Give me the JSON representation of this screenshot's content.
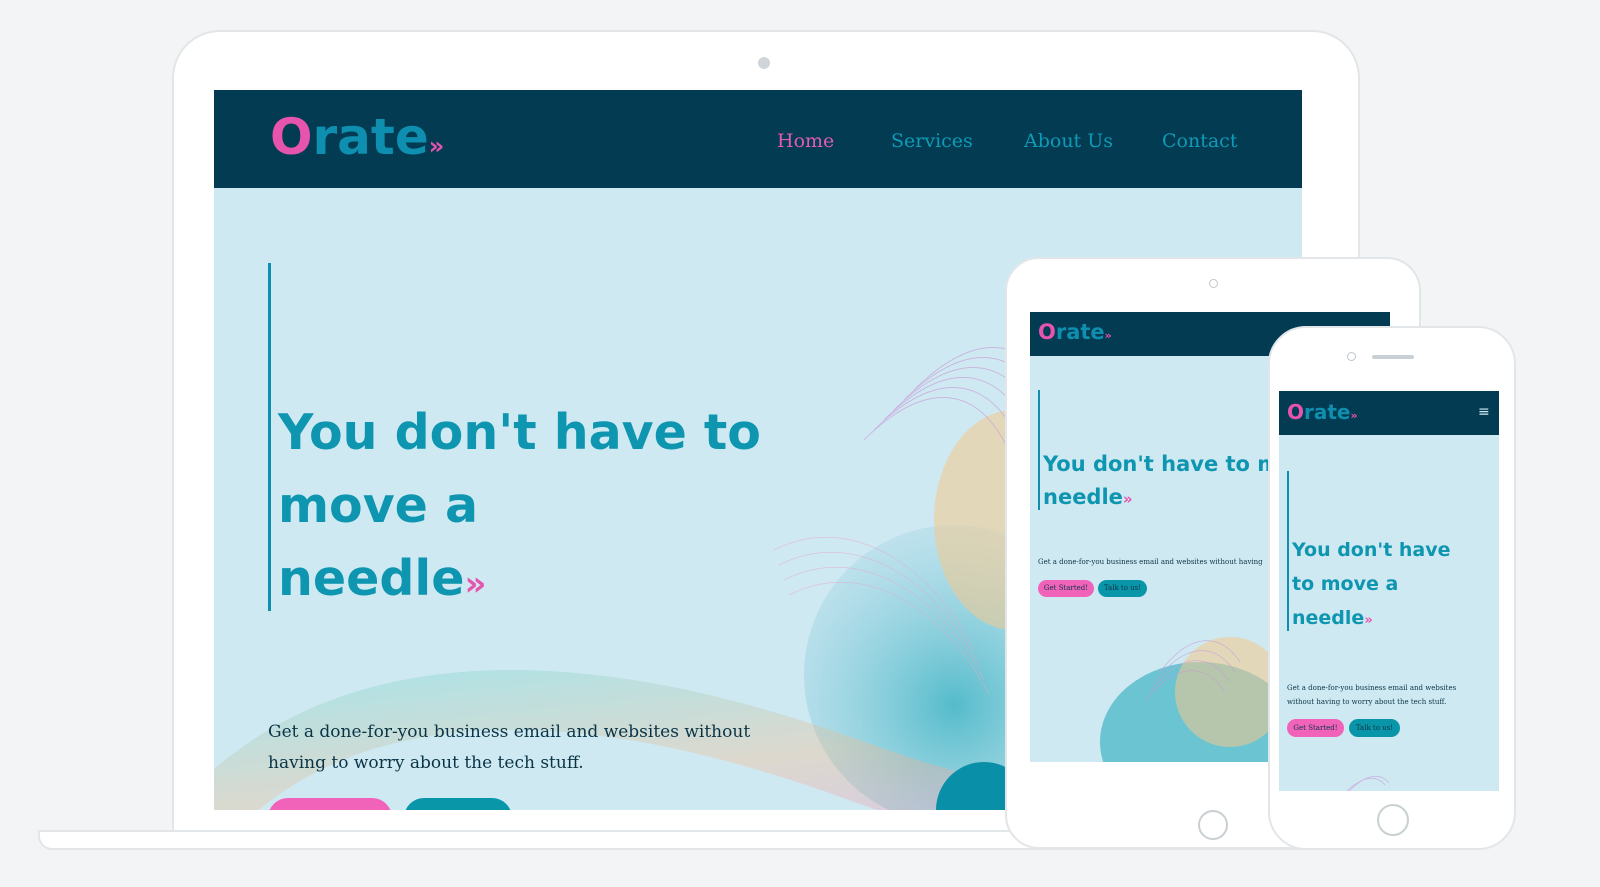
{
  "colors": {
    "navy": "#033b52",
    "teal": "#0e95b0",
    "pink": "#e754ad",
    "hero_bg": "#cfe9f2",
    "frame_bg": "#f3f4f5"
  },
  "logo": {
    "o": "O",
    "rest": "rate",
    "chevron": "»"
  },
  "nav": {
    "home": "Home",
    "services": "Services",
    "about": "About Us",
    "contact": "Contact"
  },
  "hero": {
    "line1": "You don't have to",
    "line2": "move  a",
    "line3": "needle",
    "tablet_line1": "You don't have to m",
    "phone_line1": "You don't have",
    "phone_line2": "to move  a",
    "accent": "»",
    "subtitle_line1": "Get a done-for-you business email and websites without",
    "subtitle_line2": "having to worry about the tech stuff.",
    "tablet_subtitle": "Get a done-for-you business email and websites without having",
    "phone_subtitle_line1": "Get a done-for-you business email and websites",
    "phone_subtitle_line2": "without having to worry about the tech stuff."
  },
  "buttons": {
    "primary": "Get Started!",
    "secondary": "Talk to us!"
  },
  "icons": {
    "menu": "hamburger-menu-icon"
  }
}
